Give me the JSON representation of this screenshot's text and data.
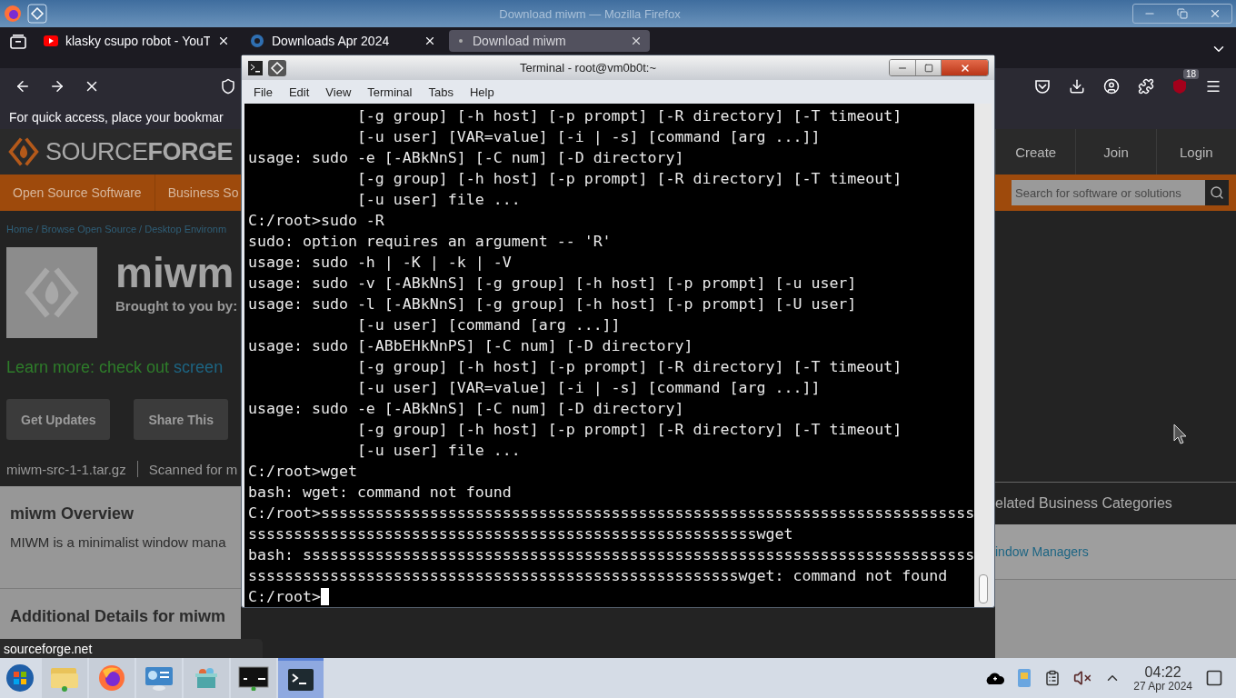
{
  "firefox_window": {
    "title": "Download miwm — Mozilla Firefox"
  },
  "tabs": [
    {
      "label": "klasky csupo robot - YouT",
      "kind": "video",
      "selected": false
    },
    {
      "label": "Downloads Apr 2024",
      "kind": "wiki",
      "selected": false
    },
    {
      "label": "Download miwm",
      "kind": "loading",
      "selected": true
    }
  ],
  "toolbar": {
    "badge": "18"
  },
  "bookmarks_hint": "For quick access, place your bookmar",
  "site": {
    "logo": "SOURCE**FORGE**",
    "header_links": [
      "Create",
      "Join",
      "Login"
    ],
    "nav": [
      "Open Source Software",
      "Business So"
    ],
    "search": {
      "placeholder": "Search for software or solutions"
    }
  },
  "breadcrumb": "Home / Browse Open Source / Desktop Environm",
  "project": {
    "name": "miwm",
    "byline": "Brought to you by:"
  },
  "learn_more": {
    "text": "Learn more: check out",
    "link": "screen"
  },
  "buttons": [
    "Get Updates",
    "Share This"
  ],
  "file": {
    "name": "miwm-src-1-1.tar.gz",
    "scan": "Scanned for m"
  },
  "overview": {
    "title": "miwm Overview",
    "text": "MIWM is a minimalist window mana"
  },
  "details_title": "Additional Details for miwm",
  "related": {
    "title": "elated Business Categories",
    "link": "indow Managers"
  },
  "status_url": "sourceforge.net",
  "terminal": {
    "title": "Terminal - root@vm0b0t:~",
    "menu": [
      "File",
      "Edit",
      "View",
      "Terminal",
      "Tabs",
      "Help"
    ],
    "lines": [
      "            [-g group] [-h host] [-p prompt] [-R directory] [-T timeout]",
      "            [-u user] [VAR=value] [-i | -s] [command [arg ...]]",
      "usage: sudo -e [-ABkNnS] [-C num] [-D directory]",
      "            [-g group] [-h host] [-p prompt] [-R directory] [-T timeout]",
      "            [-u user] file ...",
      "C:/root>sudo -R",
      "sudo: option requires an argument -- 'R'",
      "usage: sudo -h | -K | -k | -V",
      "usage: sudo -v [-ABkNnS] [-g group] [-h host] [-p prompt] [-u user]",
      "usage: sudo -l [-ABkNnS] [-g group] [-h host] [-p prompt] [-U user]",
      "            [-u user] [command [arg ...]]",
      "usage: sudo [-ABbEHkNnPS] [-C num] [-D directory]",
      "            [-g group] [-h host] [-p prompt] [-R directory] [-T timeout]",
      "            [-u user] [VAR=value] [-i | -s] [command [arg ...]]",
      "usage: sudo -e [-ABkNnS] [-C num] [-D directory]",
      "            [-g group] [-h host] [-p prompt] [-R directory] [-T timeout]",
      "            [-u user] file ...",
      "C:/root>wget",
      "bash: wget: command not found",
      "C:/root>ssssssssssssssssssssssssssssssssssssssssssssssssssssssssssssssssssssssss",
      "sssssssssssssssssssssssssssssssssssssssssssssssssssssssswget",
      "bash: ssssssssssssssssssssssssssssssssssssssssssssssssssssssssssssssssssssssssss",
      "sssssssssssssssssssssssssssssssssssssssssssssssssssssswget: command not found",
      "C:/root>"
    ]
  },
  "taskbar": {
    "apps": [
      {
        "kind": "folder",
        "selected": false
      },
      {
        "kind": "firefox",
        "selected": false
      },
      {
        "kind": "control-panel",
        "selected": false
      },
      {
        "kind": "network",
        "selected": false
      },
      {
        "kind": "console",
        "selected": false
      },
      {
        "kind": "terminal",
        "selected": true
      }
    ],
    "muted": true,
    "time": "04:22",
    "date": "27 Apr 2024"
  }
}
